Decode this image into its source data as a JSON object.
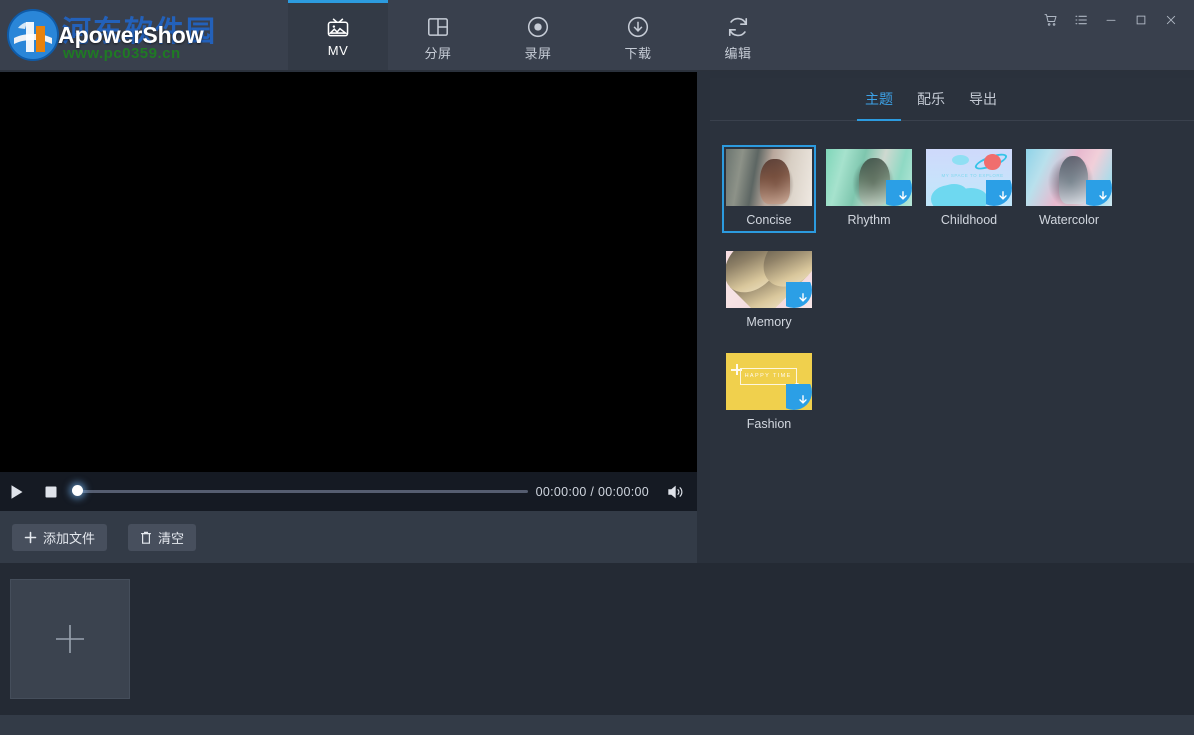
{
  "app": {
    "brand_name": "ApowerShow",
    "brand_cn": "河东软件园",
    "brand_url": "www.pc0359.cn"
  },
  "nav": {
    "tabs": [
      {
        "label": "MV",
        "icon": "tv-photo-icon",
        "active": true
      },
      {
        "label": "分屏",
        "icon": "split-screen-icon",
        "active": false
      },
      {
        "label": "录屏",
        "icon": "record-icon",
        "active": false
      },
      {
        "label": "下载",
        "icon": "download-icon",
        "active": false
      },
      {
        "label": "编辑",
        "icon": "edit-refresh-icon",
        "active": false
      }
    ]
  },
  "window_controls": [
    {
      "name": "cart-icon",
      "glyph": "cart"
    },
    {
      "name": "list-menu-icon",
      "glyph": "list"
    },
    {
      "name": "minimize-icon",
      "glyph": "minimize"
    },
    {
      "name": "maximize-icon",
      "glyph": "maximize"
    },
    {
      "name": "close-icon",
      "glyph": "close"
    }
  ],
  "player": {
    "play_label": "play",
    "stop_label": "stop",
    "time": "00:00:00 / 00:00:00",
    "progress_percent": 0,
    "volume_label": "volume"
  },
  "actions": {
    "add_file_label": "添加文件",
    "clear_label": "清空"
  },
  "timeline": {
    "add_slot_label": "+"
  },
  "right_panel": {
    "tabs": [
      {
        "label": "主题",
        "active": true
      },
      {
        "label": "配乐",
        "active": false
      },
      {
        "label": "导出",
        "active": false
      }
    ],
    "themes": [
      {
        "label": "Concise",
        "art": "art-concise",
        "selected": true,
        "downloadable": false
      },
      {
        "label": "Rhythm",
        "art": "art-rhythm",
        "selected": false,
        "downloadable": true
      },
      {
        "label": "Childhood",
        "art": "art-childhood",
        "selected": false,
        "downloadable": true
      },
      {
        "label": "Watercolor",
        "art": "art-watercolor",
        "selected": false,
        "downloadable": true
      },
      {
        "label": "Memory",
        "art": "art-memory",
        "selected": false,
        "downloadable": true
      },
      {
        "label": "Fashion",
        "art": "art-fashion",
        "selected": false,
        "downloadable": true
      }
    ],
    "childhood_caption": "MY SPACE TO EXPLORE",
    "fashion_caption": "HAPPY TIME"
  },
  "colors": {
    "accent": "#2c9bdf",
    "titlebar_bg": "#39404d",
    "panel_bg": "#2b323d",
    "timeline_bg": "#242a34",
    "action_bg": "#333b47",
    "preview_bg": "#000000",
    "badge_blue": "#2b9fe6",
    "fashion_yellow": "#f0d04d"
  }
}
